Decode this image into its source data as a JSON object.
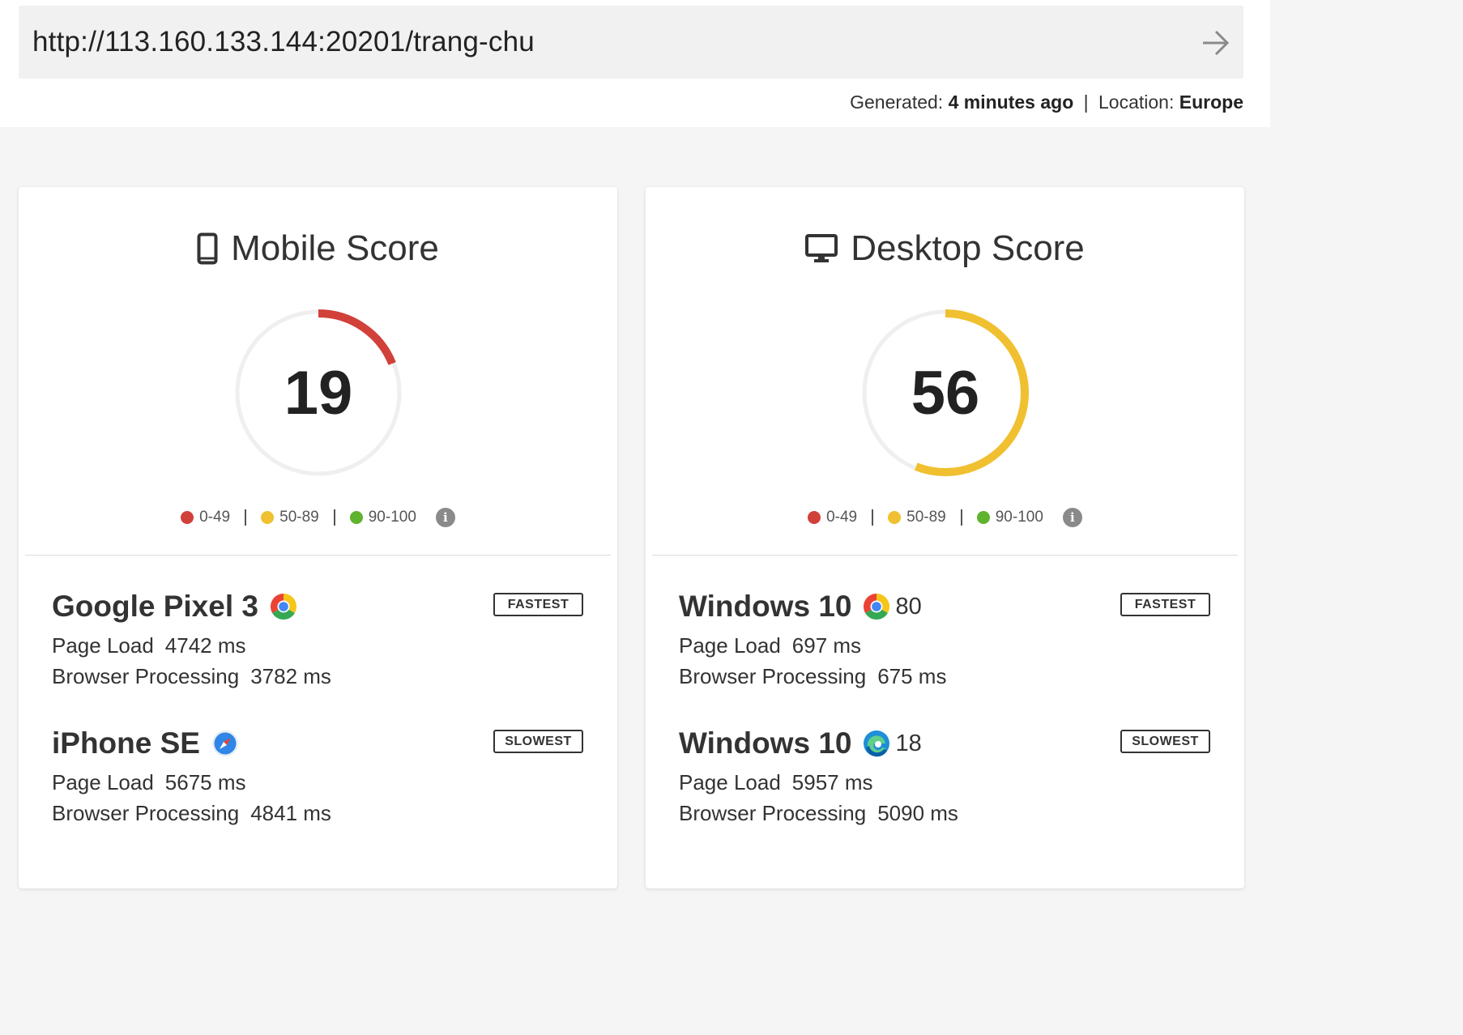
{
  "url_bar": {
    "url": "http://113.160.133.144:20201/trang-chu",
    "submit_icon": "arrow-right-icon"
  },
  "meta": {
    "generated_label": "Generated:",
    "generated_value": "4 minutes ago",
    "separator": "|",
    "location_label": "Location:",
    "location_value": "Europe"
  },
  "legend": {
    "ranges": [
      "0-49",
      "50-89",
      "90-100"
    ],
    "colors": {
      "poor": "#d2403a",
      "average": "#f0c030",
      "good": "#5fb32e"
    },
    "info_icon": "info-icon"
  },
  "mobile": {
    "title": "Mobile Score",
    "icon": "mobile-phone-icon",
    "score": "19",
    "score_fraction": 0.19,
    "gauge_color": "#d2403a",
    "devices": [
      {
        "name": "Google Pixel 3",
        "browser_icon": "chrome-icon",
        "browser_version": "",
        "badge": "FASTEST",
        "page_load_label": "Page Load",
        "page_load_value": "4742 ms",
        "processing_label": "Browser Processing",
        "processing_value": "3782 ms"
      },
      {
        "name": "iPhone SE",
        "browser_icon": "safari-icon",
        "browser_version": "",
        "badge": "SLOWEST",
        "page_load_label": "Page Load",
        "page_load_value": "5675 ms",
        "processing_label": "Browser Processing",
        "processing_value": "4841 ms"
      }
    ]
  },
  "desktop": {
    "title": "Desktop Score",
    "icon": "desktop-monitor-icon",
    "score": "56",
    "score_fraction": 0.56,
    "gauge_color": "#f0c030",
    "devices": [
      {
        "name": "Windows 10",
        "browser_icon": "chrome-icon",
        "browser_version": "80",
        "badge": "FASTEST",
        "page_load_label": "Page Load",
        "page_load_value": "697 ms",
        "processing_label": "Browser Processing",
        "processing_value": "675 ms"
      },
      {
        "name": "Windows 10",
        "browser_icon": "edge-icon",
        "browser_version": "18",
        "badge": "SLOWEST",
        "page_load_label": "Page Load",
        "page_load_value": "5957 ms",
        "processing_label": "Browser Processing",
        "processing_value": "5090 ms"
      }
    ]
  }
}
